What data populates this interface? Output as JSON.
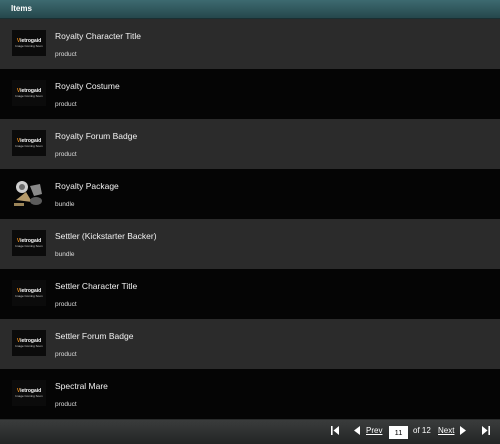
{
  "header": {
    "title": "Items"
  },
  "thumb": {
    "logo_prefix": "V",
    "logo_text": "ietrogaid",
    "logo_sub": "Image Coming Soon"
  },
  "items": [
    {
      "name": "Royalty Character Title",
      "kind": "product",
      "thumb": "placeholder"
    },
    {
      "name": "Royalty Costume",
      "kind": "product",
      "thumb": "placeholder"
    },
    {
      "name": "Royalty Forum Badge",
      "kind": "product",
      "thumb": "placeholder"
    },
    {
      "name": "Royalty Package",
      "kind": "bundle",
      "thumb": "package"
    },
    {
      "name": "Settler (Kickstarter Backer)",
      "kind": "bundle",
      "thumb": "placeholder"
    },
    {
      "name": "Settler Character Title",
      "kind": "product",
      "thumb": "placeholder"
    },
    {
      "name": "Settler Forum Badge",
      "kind": "product",
      "thumb": "placeholder"
    },
    {
      "name": "Spectral Mare",
      "kind": "product",
      "thumb": "placeholder"
    }
  ],
  "pager": {
    "first_icon": "first-page-icon",
    "prev_icon": "prev-page-icon",
    "prev_label": "Prev",
    "current_page": "11",
    "of_label": "of 12",
    "next_label": "Next",
    "next_icon": "next-page-icon",
    "last_icon": "last-page-icon"
  }
}
